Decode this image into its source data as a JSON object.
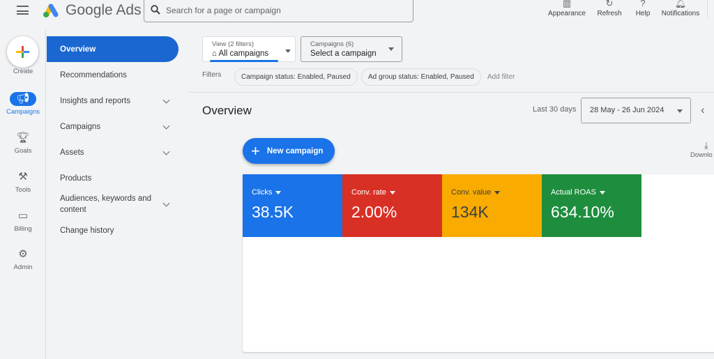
{
  "header": {
    "app_name": "Google Ads",
    "search_placeholder": "Search for a page or campaign",
    "actions": [
      {
        "label": "Appearance",
        "icon": "appearance-icon"
      },
      {
        "label": "Refresh",
        "icon": "refresh-icon"
      },
      {
        "label": "Help",
        "icon": "help-icon"
      },
      {
        "label": "Notifications",
        "icon": "bell-icon"
      }
    ]
  },
  "rail": {
    "create": "Create",
    "items": [
      {
        "label": "Campaigns",
        "icon": "megaphone-icon",
        "active": true
      },
      {
        "label": "Goals",
        "icon": "trophy-icon"
      },
      {
        "label": "Tools",
        "icon": "tools-icon"
      },
      {
        "label": "Billing",
        "icon": "card-icon"
      },
      {
        "label": "Admin",
        "icon": "gear-icon"
      }
    ]
  },
  "nav": {
    "items": [
      {
        "label": "Overview",
        "active": true
      },
      {
        "label": "Recommendations"
      },
      {
        "label": "Insights and reports",
        "expandable": true
      },
      {
        "label": "Campaigns",
        "expandable": true
      },
      {
        "label": "Assets",
        "expandable": true
      },
      {
        "label": "Products"
      },
      {
        "label": "Audiences, keywords and content",
        "expandable": true
      },
      {
        "label": "Change history"
      }
    ]
  },
  "filters_bar": {
    "view_label": "View (2 filters)",
    "view_value": "All campaigns",
    "campaigns_label": "Campaigns (6)",
    "campaigns_value": "Select a campaign",
    "filters_label": "Filters",
    "chips": [
      "Campaign status: Enabled, Paused",
      "Ad group status: Enabled, Paused"
    ],
    "add_filter": "Add filter"
  },
  "main": {
    "title": "Overview",
    "range_label": "Last 30 days",
    "date_range": "28 May - 26 Jun 2024",
    "new_campaign": "New campaign",
    "download": "Downlo"
  },
  "metrics": [
    {
      "label": "Clicks",
      "value": "38.5K",
      "color": "#1a73e8"
    },
    {
      "label": "Conv. rate",
      "value": "2.00%",
      "color": "#d93025"
    },
    {
      "label": "Conv. value",
      "value": "134K",
      "color": "#f9ab00"
    },
    {
      "label": "Actual ROAS",
      "value": "634.10%",
      "color": "#1e8e3e"
    }
  ]
}
